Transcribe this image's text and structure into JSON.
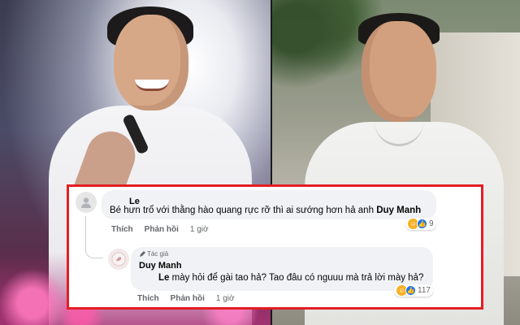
{
  "comment1": {
    "author": "Le",
    "text": "Bé hưn trổ với thằng hào quang rực rỡ thì ai sướng hơn hả anh",
    "mention": "Duy Manh",
    "actions": {
      "like": "Thích",
      "reply": "Phản hồi",
      "time": "1 giờ"
    },
    "reaction_count": "9",
    "reaction_icons": [
      "haha-icon",
      "like-icon"
    ]
  },
  "comment2": {
    "badge": "Tác giả",
    "author": "Duy Manh",
    "mention": "Le",
    "text": "mày hỏi để gài tao hả? Tao đâu có nguuu mà trả lời mày hả?",
    "actions": {
      "like": "Thích",
      "reply": "Phản hồi",
      "time": "1 giờ"
    },
    "reaction_count": "117",
    "reaction_icons": [
      "haha-icon",
      "like-icon"
    ]
  },
  "colors": {
    "frame": "#e31e24",
    "bubble": "#f0f2f5",
    "like_blue": "#1877f2",
    "haha_yellow": "#f7b125"
  }
}
